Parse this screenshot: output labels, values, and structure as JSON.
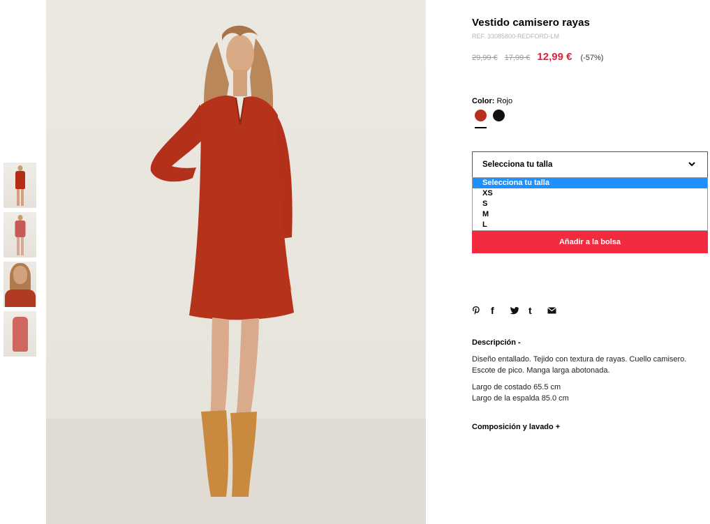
{
  "product": {
    "title": "Vestido camisero rayas",
    "ref": "REF. 33085800-REDFORD-LM",
    "price_original": "29,99 €",
    "price_previous": "17,99 €",
    "price_sale": "12,99 €",
    "discount": "(-57%)"
  },
  "color": {
    "label": "Color:",
    "value": "Rojo",
    "swatches": [
      {
        "name": "Rojo",
        "hex": "#b82f1e",
        "selected": true
      },
      {
        "name": "Negro",
        "hex": "#111111",
        "selected": false
      }
    ]
  },
  "size_select": {
    "current": "Selecciona tu talla",
    "options": [
      "Selecciona tu talla",
      "XS",
      "S",
      "M",
      "L"
    ],
    "highlighted_index": 0
  },
  "add_to_bag": "Añadir a la bolsa",
  "social": {
    "pinterest": "P",
    "facebook": "f",
    "twitter": "t",
    "tumblr": "t"
  },
  "description": {
    "heading": "Descripción -",
    "text": "Diseño entallado. Tejido con textura de rayas. Cuello camisero. Escote de pico. Manga larga abotonada.",
    "measure_1": "Largo de costado 65.5 cm",
    "measure_2": "Largo de la espalda 85.0 cm"
  },
  "composition": {
    "heading": "Composición y lavado +"
  },
  "colors": {
    "accent_red": "#f22b3f",
    "price_red": "#e3213a",
    "option_highlight": "#1e90ff"
  }
}
